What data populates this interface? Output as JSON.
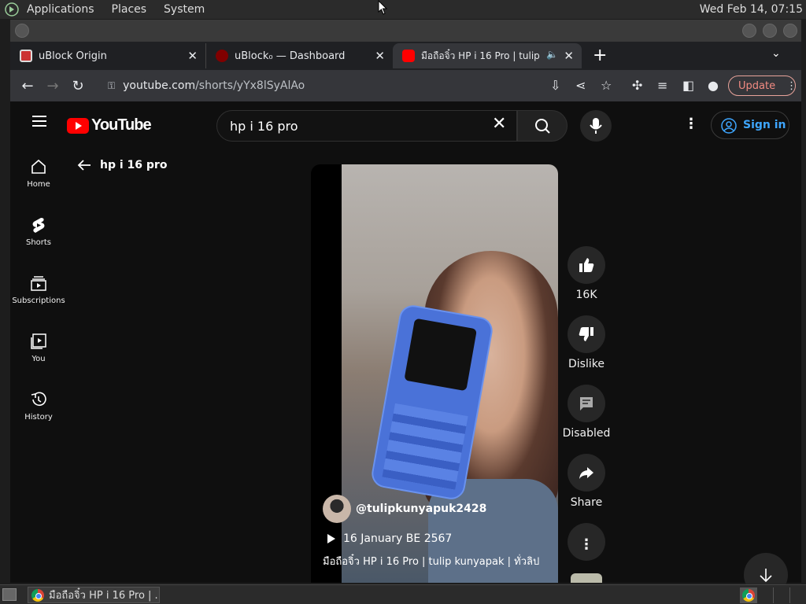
{
  "topbar": {
    "menus": [
      "Applications",
      "Places",
      "System"
    ],
    "clock": "Wed Feb 14, 07:15"
  },
  "tabs": [
    {
      "title": "uBlock Origin",
      "active": false
    },
    {
      "title": "uBlock₀ — Dashboard",
      "active": false
    },
    {
      "title": "มือถือจิ๋ว HP i 16 Pro | tulip",
      "active": true
    }
  ],
  "address": {
    "host": "youtube.com",
    "path": "/shorts/yYx8lSyAlAo",
    "update_label": "Update"
  },
  "youtube": {
    "logo": "YouTube",
    "search_value": "hp i 16 pro",
    "signin_label": "Sign in",
    "sidebar": [
      {
        "label": "Home",
        "icon": "home-icon"
      },
      {
        "label": "Shorts",
        "icon": "shorts-icon"
      },
      {
        "label": "Subscriptions",
        "icon": "subscriptions-icon"
      },
      {
        "label": "You",
        "icon": "you-icon"
      },
      {
        "label": "History",
        "icon": "history-icon"
      }
    ],
    "back_label": "hp i 16 pro",
    "channel": "@tulipkunyapuk2428",
    "date": "16 January BE 2567",
    "description": "มือถือจิ๋ว HP i 16 Pro | tulip kunyapak | ทั่วลิป",
    "actions": {
      "like_count": "16K",
      "dislike_label": "Dislike",
      "comments_label": "Disabled",
      "share_label": "Share"
    }
  },
  "taskbar": {
    "window_title": "มือถือจิ๋ว HP i 16 Pro | ..."
  }
}
